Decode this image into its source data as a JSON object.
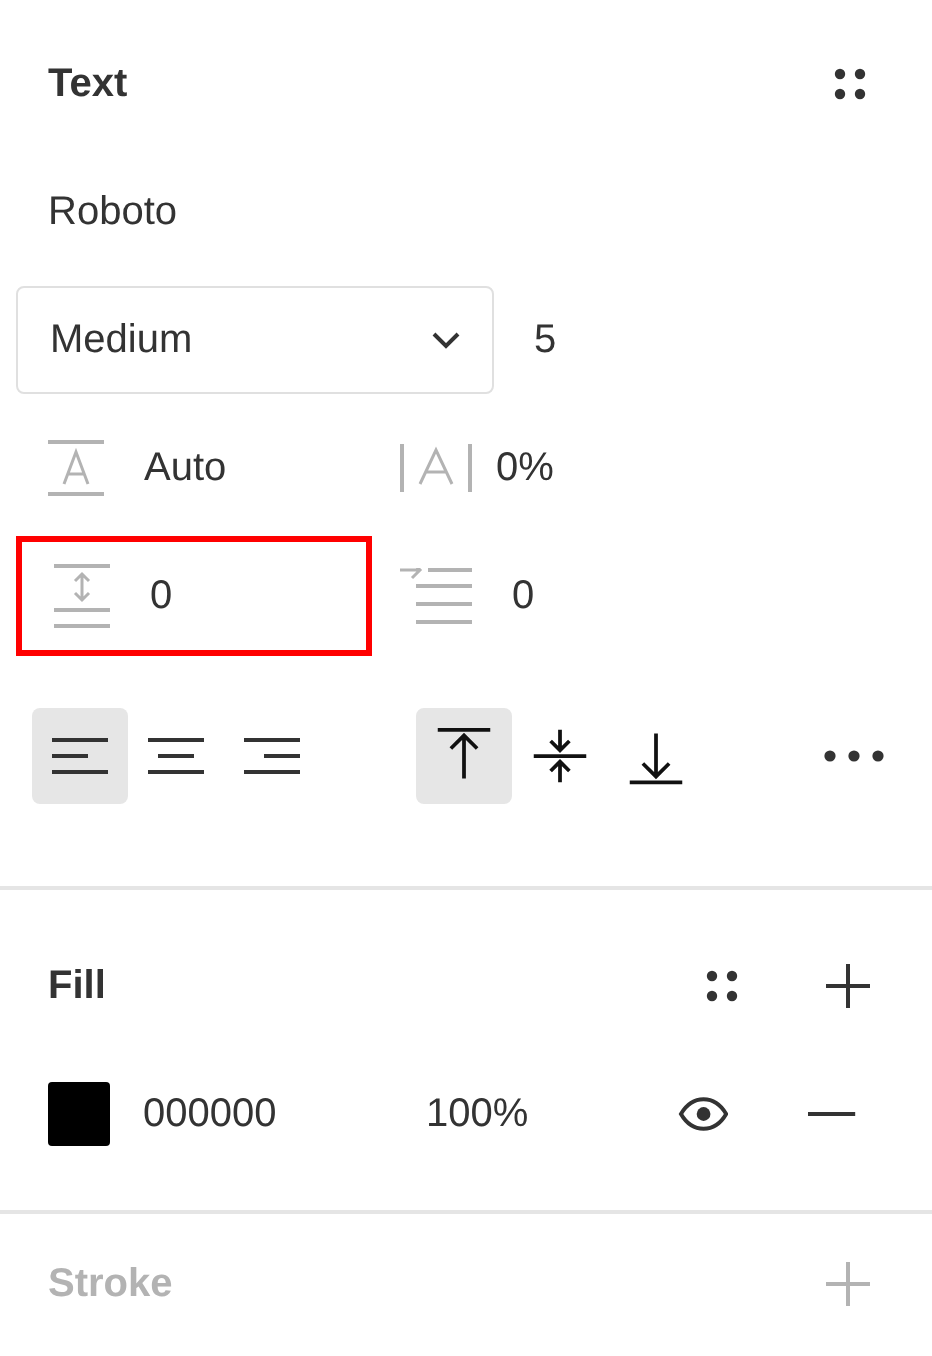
{
  "text_section": {
    "title": "Text"
  },
  "font_family": "Roboto",
  "font_weight": {
    "value": "Medium"
  },
  "font_size": "5",
  "line_height": {
    "value": "Auto"
  },
  "letter_spacing": {
    "value": "0%"
  },
  "paragraph_spacing": {
    "value": "0",
    "highlighted": true
  },
  "paragraph_indent": {
    "value": "0"
  },
  "horizontal_align": [
    {
      "kind": "left",
      "selected": true
    },
    {
      "kind": "center",
      "selected": false
    },
    {
      "kind": "right",
      "selected": false
    }
  ],
  "vertical_align": [
    {
      "kind": "top",
      "selected": true
    },
    {
      "kind": "middle",
      "selected": false
    },
    {
      "kind": "bottom",
      "selected": false
    }
  ],
  "fill": {
    "title": "Fill",
    "layers": [
      {
        "hex": "000000",
        "opacity": "100%",
        "color": "#000000",
        "visible": true
      }
    ]
  },
  "stroke": {
    "title": "Stroke",
    "disabled": true
  }
}
